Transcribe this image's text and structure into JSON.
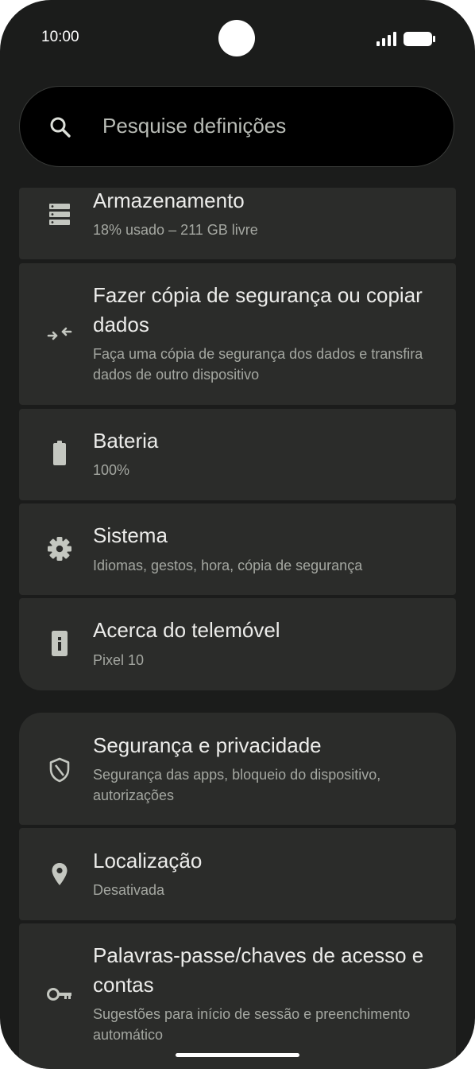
{
  "status_bar": {
    "time": "10:00"
  },
  "search": {
    "placeholder": "Pesquise definições"
  },
  "settings_items": [
    {
      "title": "Armazenamento",
      "subtitle": "18% usado – 211 GB livre",
      "icon": "storage-icon"
    },
    {
      "title": "Fazer cópia de segurança ou copiar dados",
      "subtitle": "Faça uma cópia de segurança dos dados e transfira dados de outro dispositivo",
      "icon": "backup-transfer-icon"
    },
    {
      "title": "Bateria",
      "subtitle": "100%",
      "icon": "battery-icon"
    },
    {
      "title": "Sistema",
      "subtitle": "Idiomas, gestos, hora, cópia de segurança",
      "icon": "gear-icon"
    },
    {
      "title": "Acerca do telemóvel",
      "subtitle": "Pixel 10",
      "icon": "phone-info-icon"
    },
    {
      "title": "Segurança e privacidade",
      "subtitle": "Segurança das apps, bloqueio do dispositivo, autorizações",
      "icon": "shield-icon"
    },
    {
      "title": "Localização",
      "subtitle": "Desativada",
      "icon": "location-pin-icon"
    },
    {
      "title": "Palavras-passe/chaves de acesso e contas",
      "subtitle": "Sugestões para início de sessão e preenchimento automático",
      "icon": "key-icon"
    }
  ],
  "colors": {
    "background": "#1b1c1b",
    "card": "#2b2c2a",
    "title_text": "#ececea",
    "subtitle_text": "#a4a7a1",
    "icon": "#c4c7c0"
  }
}
